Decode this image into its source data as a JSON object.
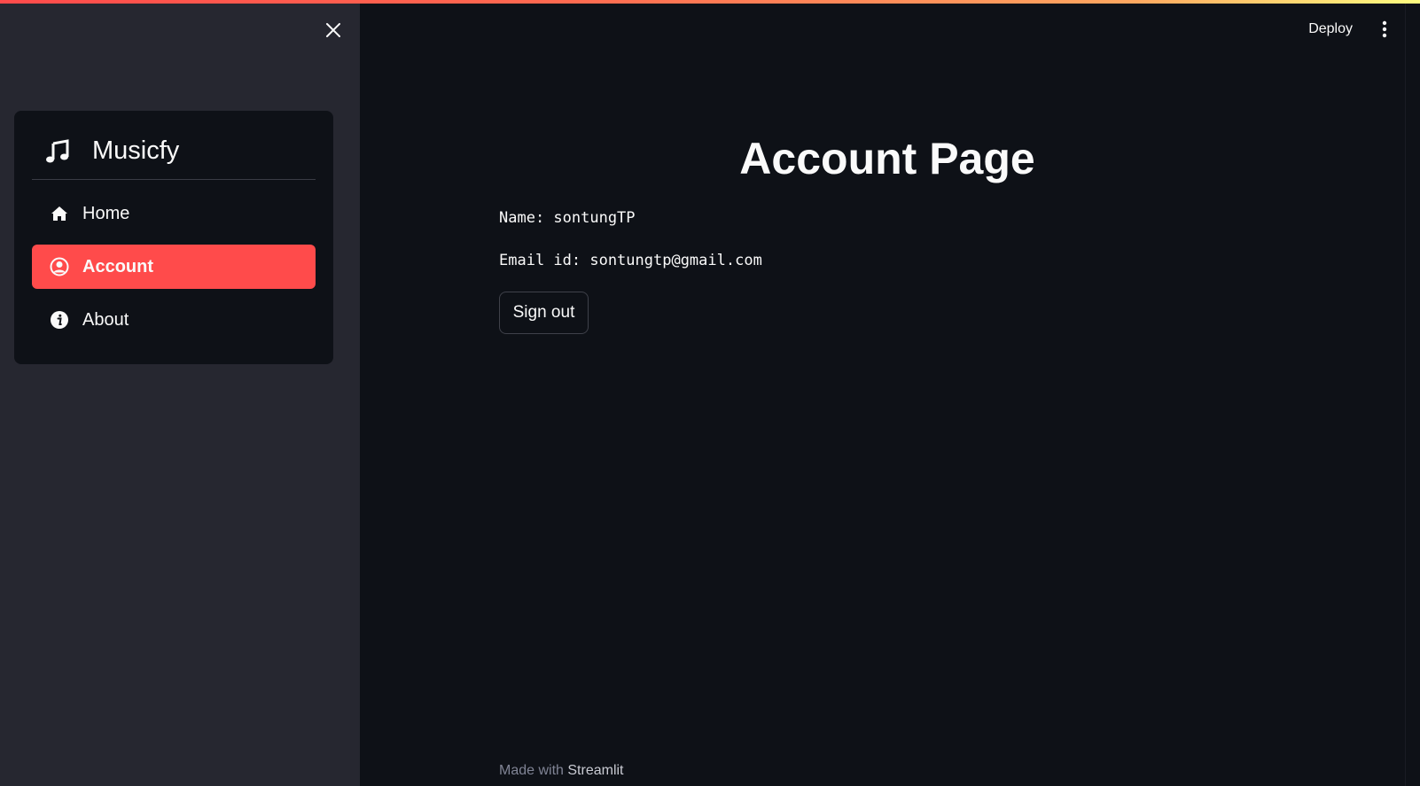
{
  "header": {
    "deploy_label": "Deploy",
    "icons": {
      "menu": "kebab-menu-icon",
      "close": "close-icon"
    }
  },
  "sidebar": {
    "menu_title": "Musicfy",
    "title_icon": "music-note-icon",
    "items": [
      {
        "label": "Home",
        "icon": "house-icon",
        "active": false
      },
      {
        "label": "Account",
        "icon": "person-circle-icon",
        "active": true
      },
      {
        "label": "About",
        "icon": "info-circle-icon",
        "active": false
      }
    ]
  },
  "main": {
    "title": "Account Page",
    "name_line": "Name: sontungTP",
    "email_line": "Email id: sontungtp@gmail.com",
    "signout_label": "Sign out"
  },
  "footer": {
    "prefix": "Made with",
    "brand": "Streamlit"
  },
  "colors": {
    "accent": "#ff4b4b",
    "background": "#0e1117",
    "sidebar_bg": "#262730",
    "text": "#fafafa"
  }
}
